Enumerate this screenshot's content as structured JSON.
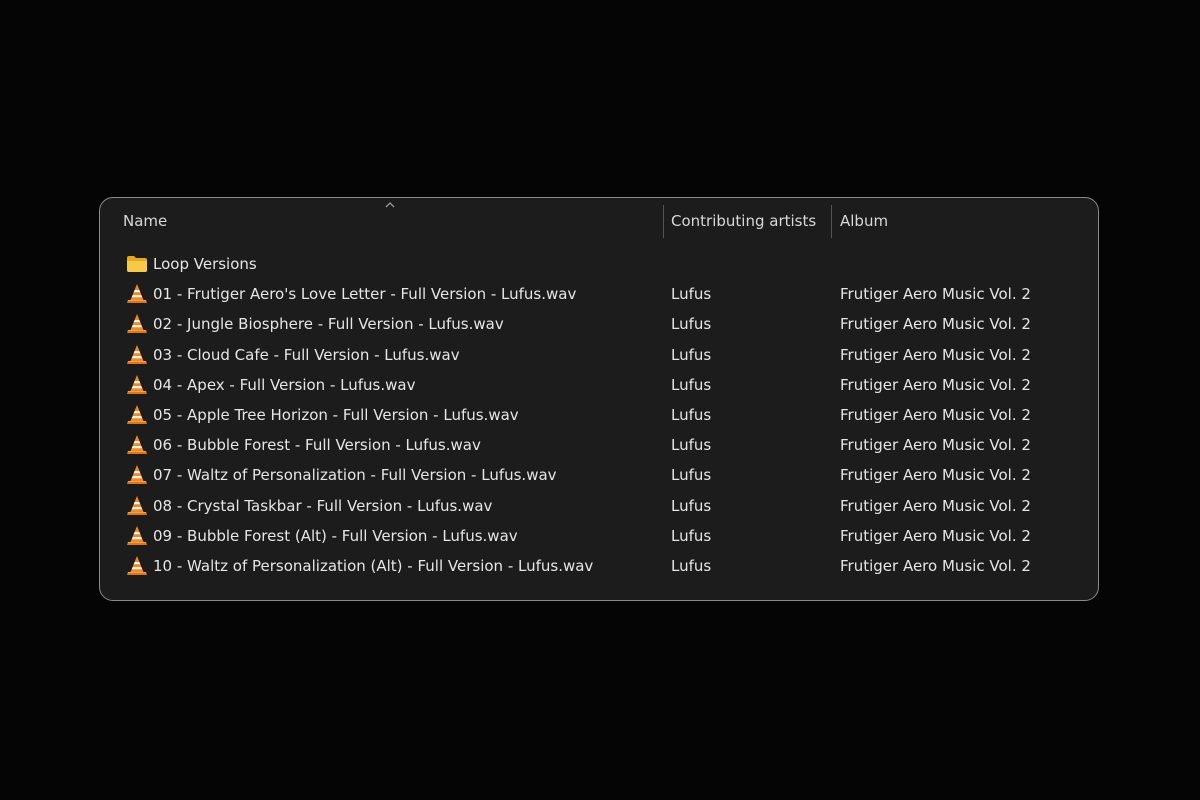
{
  "columns": {
    "name": "Name",
    "artists": "Contributing artists",
    "album": "Album"
  },
  "sort": {
    "column": "name",
    "direction": "ascending",
    "icon": "chevron-up-icon"
  },
  "folder": {
    "name": "Loop Versions",
    "icon": "folder-icon",
    "color": "#f4c542"
  },
  "files": [
    {
      "name": "01 - Frutiger Aero's Love Letter - Full Version - Lufus.wav",
      "artist": "Lufus",
      "album": "Frutiger Aero Music Vol. 2",
      "icon": "vlc-cone-icon"
    },
    {
      "name": "02 - Jungle Biosphere - Full Version - Lufus.wav",
      "artist": "Lufus",
      "album": "Frutiger Aero Music Vol. 2",
      "icon": "vlc-cone-icon"
    },
    {
      "name": "03 - Cloud Cafe - Full Version - Lufus.wav",
      "artist": "Lufus",
      "album": "Frutiger Aero Music Vol. 2",
      "icon": "vlc-cone-icon"
    },
    {
      "name": "04 - Apex - Full Version - Lufus.wav",
      "artist": "Lufus",
      "album": "Frutiger Aero Music Vol. 2",
      "icon": "vlc-cone-icon"
    },
    {
      "name": "05 - Apple Tree Horizon - Full Version - Lufus.wav",
      "artist": "Lufus",
      "album": "Frutiger Aero Music Vol. 2",
      "icon": "vlc-cone-icon"
    },
    {
      "name": "06 - Bubble Forest - Full Version - Lufus.wav",
      "artist": "Lufus",
      "album": "Frutiger Aero Music Vol. 2",
      "icon": "vlc-cone-icon"
    },
    {
      "name": "07 - Waltz of Personalization - Full Version - Lufus.wav",
      "artist": "Lufus",
      "album": "Frutiger Aero Music Vol. 2",
      "icon": "vlc-cone-icon"
    },
    {
      "name": "08 - Crystal Taskbar - Full Version - Lufus.wav",
      "artist": "Lufus",
      "album": "Frutiger Aero Music Vol. 2",
      "icon": "vlc-cone-icon"
    },
    {
      "name": "09 - Bubble Forest (Alt) - Full Version - Lufus.wav",
      "artist": "Lufus",
      "album": "Frutiger Aero Music Vol. 2",
      "icon": "vlc-cone-icon"
    },
    {
      "name": "10 - Waltz of Personalization (Alt) - Full Version - Lufus.wav",
      "artist": "Lufus",
      "album": "Frutiger Aero Music Vol. 2",
      "icon": "vlc-cone-icon"
    }
  ],
  "colors": {
    "background": "#050505",
    "panel": "#1c1c1c",
    "border": "#8a8a8a",
    "text": "#e6e6e6",
    "vlc_orange": "#f28a1d"
  }
}
